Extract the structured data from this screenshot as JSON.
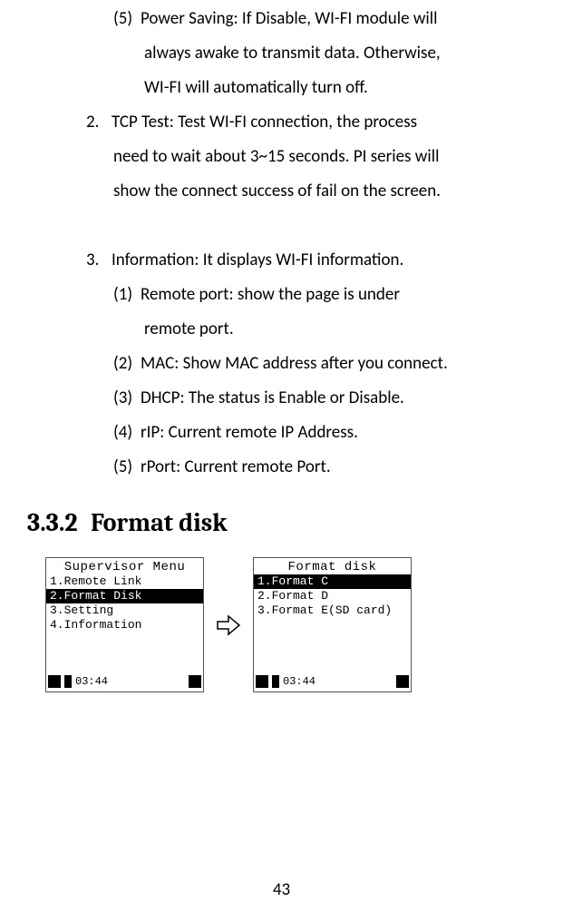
{
  "text": {
    "p1_marker": "(5)",
    "p1_l1": "Power Saving: If Disable, WI-FI module will",
    "p1_l2": "always awake to transmit data. Otherwise,",
    "p1_l3": "WI-FI will automatically turn off.",
    "p2_marker": "2.",
    "p2_l1": "TCP Test: Test WI-FI connection, the process",
    "p2_l2": "need to wait about 3~15 seconds. PI series will",
    "p2_l3": "show the connect success of fail on the screen.",
    "p3_marker": "3.",
    "p3_l1": "Information: It displays WI-FI information.",
    "p4_marker": "(1)",
    "p4_l1": "Remote port: show the page is under",
    "p4_l2": "remote port.",
    "p5_marker": "(2)",
    "p5_l1": "MAC: Show MAC address after you connect.",
    "p6_marker": "(3)",
    "p6_l1": "DHCP: The status is Enable or Disable.",
    "p7_marker": "(4)",
    "p7_l1": "rIP: Current remote IP Address.",
    "p8_marker": "(5)",
    "p8_l1": "rPort: Current remote Port."
  },
  "heading": {
    "number": "3.3.2",
    "title": "Format disk"
  },
  "screen_left": {
    "title": "Supervisor Menu",
    "items": [
      {
        "text": "1.Remote Link",
        "selected": false
      },
      {
        "text": "2.Format Disk",
        "selected": true
      },
      {
        "text": "3.Setting",
        "selected": false
      },
      {
        "text": "4.Information",
        "selected": false
      }
    ],
    "time": "03:44"
  },
  "screen_right": {
    "title": "Format disk",
    "items": [
      {
        "text": "1.Format C",
        "selected": true
      },
      {
        "text": "2.Format D",
        "selected": false
      },
      {
        "text": "3.Format E(SD card)",
        "selected": false
      }
    ],
    "time": "03:44"
  },
  "page_number": "43"
}
